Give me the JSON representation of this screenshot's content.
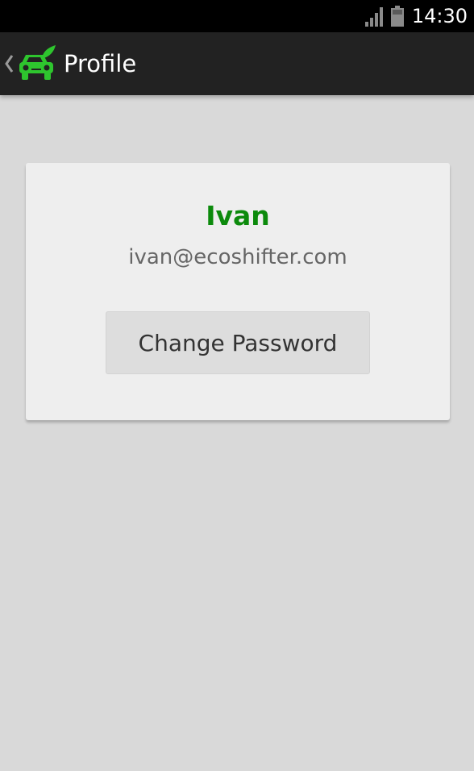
{
  "status_bar": {
    "time": "14:30",
    "icons": [
      "signal-icon",
      "battery-icon"
    ],
    "background": "#000000"
  },
  "action_bar": {
    "title": "Profile",
    "icons": [
      "back-chevron-icon",
      "car-leaf-logo-icon"
    ],
    "background": "#222222"
  },
  "profile_card": {
    "name": "Ivan",
    "email": "ivan@ecoshifter.com",
    "change_password_label": "Change Password"
  },
  "colors": {
    "accent_green": "#0c8a0c",
    "logo_green": "#2ec52e",
    "page_background": "#d9d9d9",
    "card_background": "#eeeeee"
  }
}
